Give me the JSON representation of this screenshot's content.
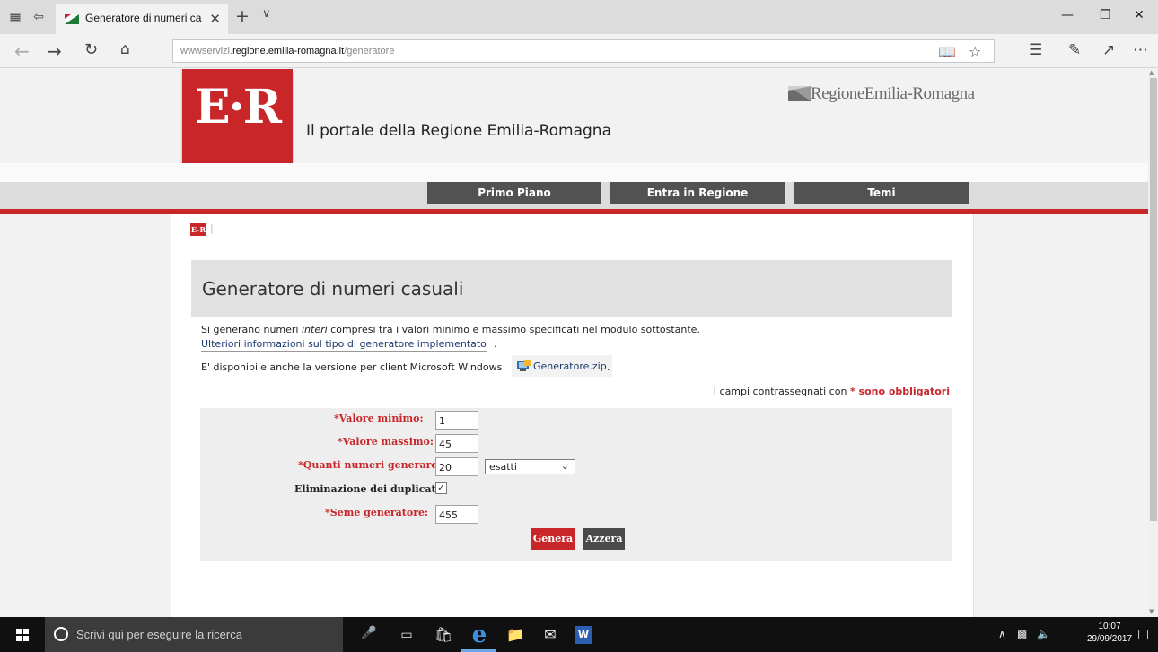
{
  "browser": {
    "tab_title": "Generatore di numeri ca",
    "new_tab": "+",
    "url_prefix": "wwwservizi.",
    "url_domain": "regione.emilia-romagna.it",
    "url_path": "/generatore"
  },
  "header": {
    "logo_text": "E·R",
    "portal_title": "Il portale della Regione Emilia-Romagna",
    "region_logo_text": "RegioneEmilia-Romagna"
  },
  "menu": {
    "items": [
      "Primo Piano",
      "Entra in Regione",
      "Temi"
    ]
  },
  "page": {
    "mini_logo": "E-R",
    "title": "Generatore di numeri casuali",
    "desc_before": "Si generano numeri ",
    "desc_italic": "interi",
    "desc_after": " compresi tra i valori minimo e massimo specificati nel modulo sottostante.",
    "info_link": "Ulteriori informazioni sul tipo di generatore implementato",
    "windows_text": "E' disponibile anche la versione per client Microsoft Windows",
    "zip_link": "Generatore.zip",
    "required_prefix": "I campi contrassegnati con ",
    "required_suffix": "* sono obbligatori"
  },
  "form": {
    "min_label": "*Valore minimo:",
    "min_value": "1",
    "max_label": "*Valore massimo:",
    "max_value": "45",
    "count_label": "*Quanti numeri generare:",
    "count_value": "20",
    "count_mode": "esatti",
    "dup_label": "Eliminazione dei duplicati:",
    "dup_checked": true,
    "seed_label": "*Seme generatore:",
    "seed_value": "455",
    "genera_label": "Genera",
    "azzera_label": "Azzera"
  },
  "taskbar": {
    "search_placeholder": "Scrivi qui per eseguire la ricerca",
    "time": "10:07",
    "date": "29/09/2017"
  },
  "colors": {
    "brand_red": "#c9262a",
    "menu_gray": "#525252",
    "taskbar": "#101010"
  }
}
